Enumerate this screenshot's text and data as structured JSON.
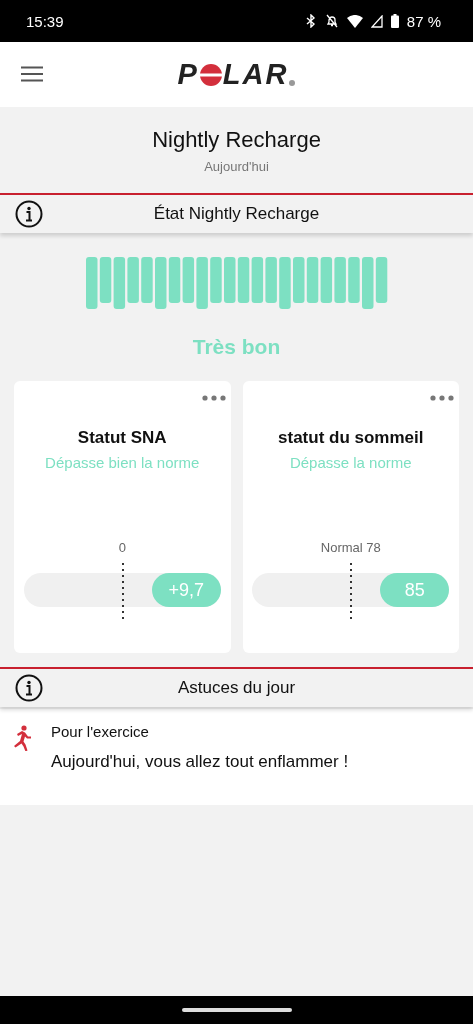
{
  "status_bar": {
    "time": "15:39",
    "battery": "87 %"
  },
  "header": {
    "logo": [
      "P",
      "LAR"
    ]
  },
  "title": {
    "heading": "Nightly Recharge",
    "date": "Aujourd'hui"
  },
  "recharge_section": {
    "title": "État Nightly Recharge",
    "rating": "Très bon"
  },
  "cards": [
    {
      "title": "Statut SNA",
      "status": "Dépasse bien la norme",
      "reference": "0",
      "value": "+9,7",
      "level": 0.35
    },
    {
      "title": "statut du sommeil",
      "status": "Dépasse la norme",
      "reference": "Normal 78",
      "value": "85",
      "level": 0.35
    }
  ],
  "tips_section": {
    "title": "Astuces du jour",
    "category": "Pour l'exercice",
    "tip": "Aujourd'hui, vous allez tout enflammer !"
  }
}
